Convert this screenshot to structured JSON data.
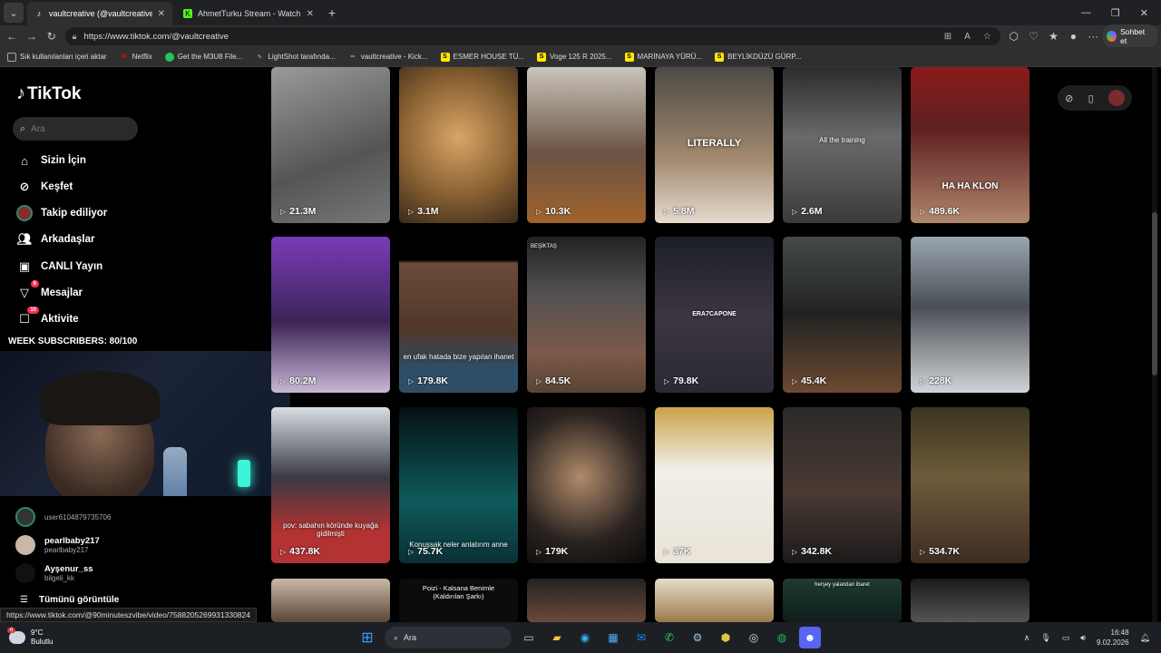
{
  "browser": {
    "tabs": [
      {
        "title": "vaultcreative (@vaultcreative) | Tik",
        "active": true,
        "favicon": "tiktok-icon"
      },
      {
        "title": "AhmetTurku Stream - Watch Live o",
        "active": false,
        "favicon": "kick-icon"
      }
    ],
    "url": "https://www.tiktok.com/@vaultcreative",
    "copilot_label": "Sohbet et",
    "bookmarks": [
      {
        "label": "Sık kullanılanları içeri aktar",
        "icon": "import-icon"
      },
      {
        "label": "Netflix",
        "icon": "netflix-icon"
      },
      {
        "label": "Get the M3U8 File...",
        "icon": "globe-icon"
      },
      {
        "label": "LightShot tarafında...",
        "icon": "feather-icon"
      },
      {
        "label": "vaultcreative - Kick...",
        "icon": "kick-icon"
      },
      {
        "label": "ESMER HOUSE TÜ...",
        "icon": "sahibinden-icon"
      },
      {
        "label": "Voge 125 R 2025...",
        "icon": "sahibinden-icon"
      },
      {
        "label": "MARİNAYA YÜRÜ...",
        "icon": "sahibinden-icon"
      },
      {
        "label": "BEYLİKDÜZÜ GÜRP...",
        "icon": "sahibinden-icon"
      }
    ]
  },
  "tiktok": {
    "logo": "TikTok",
    "search_placeholder": "Ara",
    "nav": [
      {
        "label": "Sizin İçin",
        "icon": "home-icon"
      },
      {
        "label": "Keşfet",
        "icon": "compass-icon"
      },
      {
        "label": "Takip ediliyor",
        "icon": "following-avatar-icon"
      },
      {
        "label": "Arkadaşlar",
        "icon": "friends-icon"
      },
      {
        "label": "CANLI Yayın",
        "icon": "live-icon"
      },
      {
        "label": "Mesajlar",
        "icon": "messages-icon",
        "badge": "6"
      },
      {
        "label": "Aktivite",
        "icon": "activity-icon",
        "badge": "10"
      }
    ],
    "overlay_text": "WEEK SUBSCRIBERS: 80/100",
    "following": [
      {
        "name": "",
        "handle": "user6104879735706"
      },
      {
        "name": "pearlbaby217",
        "handle": "pearlbaby217"
      },
      {
        "name": "Ayşenur_ss",
        "handle": "bilgeli_kk"
      }
    ],
    "see_all": "Tümünü görüntüle",
    "status_url": "https://www.tiktok.com/@90minuteszvibe/video/7588205269931330824",
    "videos": [
      {
        "views": "21.3M",
        "caption": ""
      },
      {
        "views": "3.1M",
        "caption": ""
      },
      {
        "views": "10.3K",
        "caption": ""
      },
      {
        "views": "5.8M",
        "caption": "LITERALLY"
      },
      {
        "views": "2.6M",
        "caption": "All the training"
      },
      {
        "views": "489.6K",
        "caption": "HA HA KLON"
      },
      {
        "views": "80.2M",
        "caption": ""
      },
      {
        "views": "179.8K",
        "caption": "en ufak hatada bize yapılan ihanet"
      },
      {
        "views": "84.5K",
        "caption": "BEŞİKTAŞ"
      },
      {
        "views": "79.8K",
        "caption": "ERA7CAPONE"
      },
      {
        "views": "45.4K",
        "caption": ""
      },
      {
        "views": "228K",
        "caption": ""
      },
      {
        "views": "437.8K",
        "caption": "pov: sabahın köründe kuyağa gidilmişti"
      },
      {
        "views": "75.7K",
        "caption": "Konuşsak neler anlatırım anne"
      },
      {
        "views": "179K",
        "caption": ""
      },
      {
        "views": "37K",
        "caption": ""
      },
      {
        "views": "342.8K",
        "caption": ""
      },
      {
        "views": "534.7K",
        "caption": ""
      },
      {
        "views": "",
        "caption": ""
      },
      {
        "views": "",
        "caption": "Poizi - Kalsana Benimle (Kaldırılan Şarkı)"
      },
      {
        "views": "",
        "caption": ""
      },
      {
        "views": "",
        "caption": ""
      },
      {
        "views": "",
        "caption": "herşey yalandan ibaret"
      },
      {
        "views": "",
        "caption": ""
      }
    ]
  },
  "taskbar": {
    "temp": "9°C",
    "weather": "Bulutlu",
    "weather_badge": "6",
    "search_placeholder": "Ara",
    "time": "16:48",
    "date": "9.02.2026"
  },
  "colors": {
    "accent": "#fe2c55",
    "tiktok_bg": "#000000",
    "taskbar": "#1c1f24"
  }
}
